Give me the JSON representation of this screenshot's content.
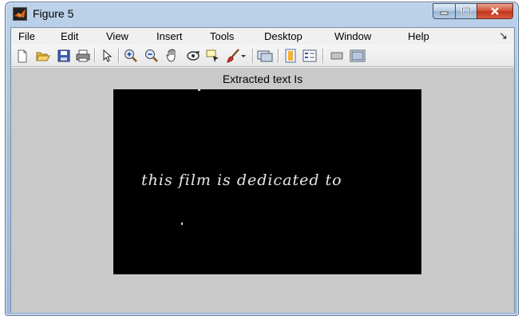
{
  "window": {
    "title": "Figure 5"
  },
  "menu": {
    "items": [
      {
        "label": "File"
      },
      {
        "label": "Edit"
      },
      {
        "label": "View"
      },
      {
        "label": "Insert"
      },
      {
        "label": "Tools"
      },
      {
        "label": "Desktop"
      },
      {
        "label": "Window"
      },
      {
        "label": "Help"
      }
    ],
    "overflow_glyph": "↘"
  },
  "toolbar": {
    "tools": [
      "new-figure-icon",
      "open-file-icon",
      "save-icon",
      "print-icon",
      "pointer-icon",
      "zoom-in-icon",
      "zoom-out-icon",
      "pan-icon",
      "rotate-3d-icon",
      "data-cursor-icon",
      "brush-icon",
      "brush-dropdown-icon",
      "link-plot-icon",
      "insert-colorbar-icon",
      "insert-legend-icon",
      "hide-plot-tools-icon",
      "show-plot-tools-icon"
    ]
  },
  "figure": {
    "axes_title": "Extracted text Is",
    "image_text": "this film is dedicated to",
    "image_background": "#000000",
    "figure_background": "#c9c9c9"
  }
}
